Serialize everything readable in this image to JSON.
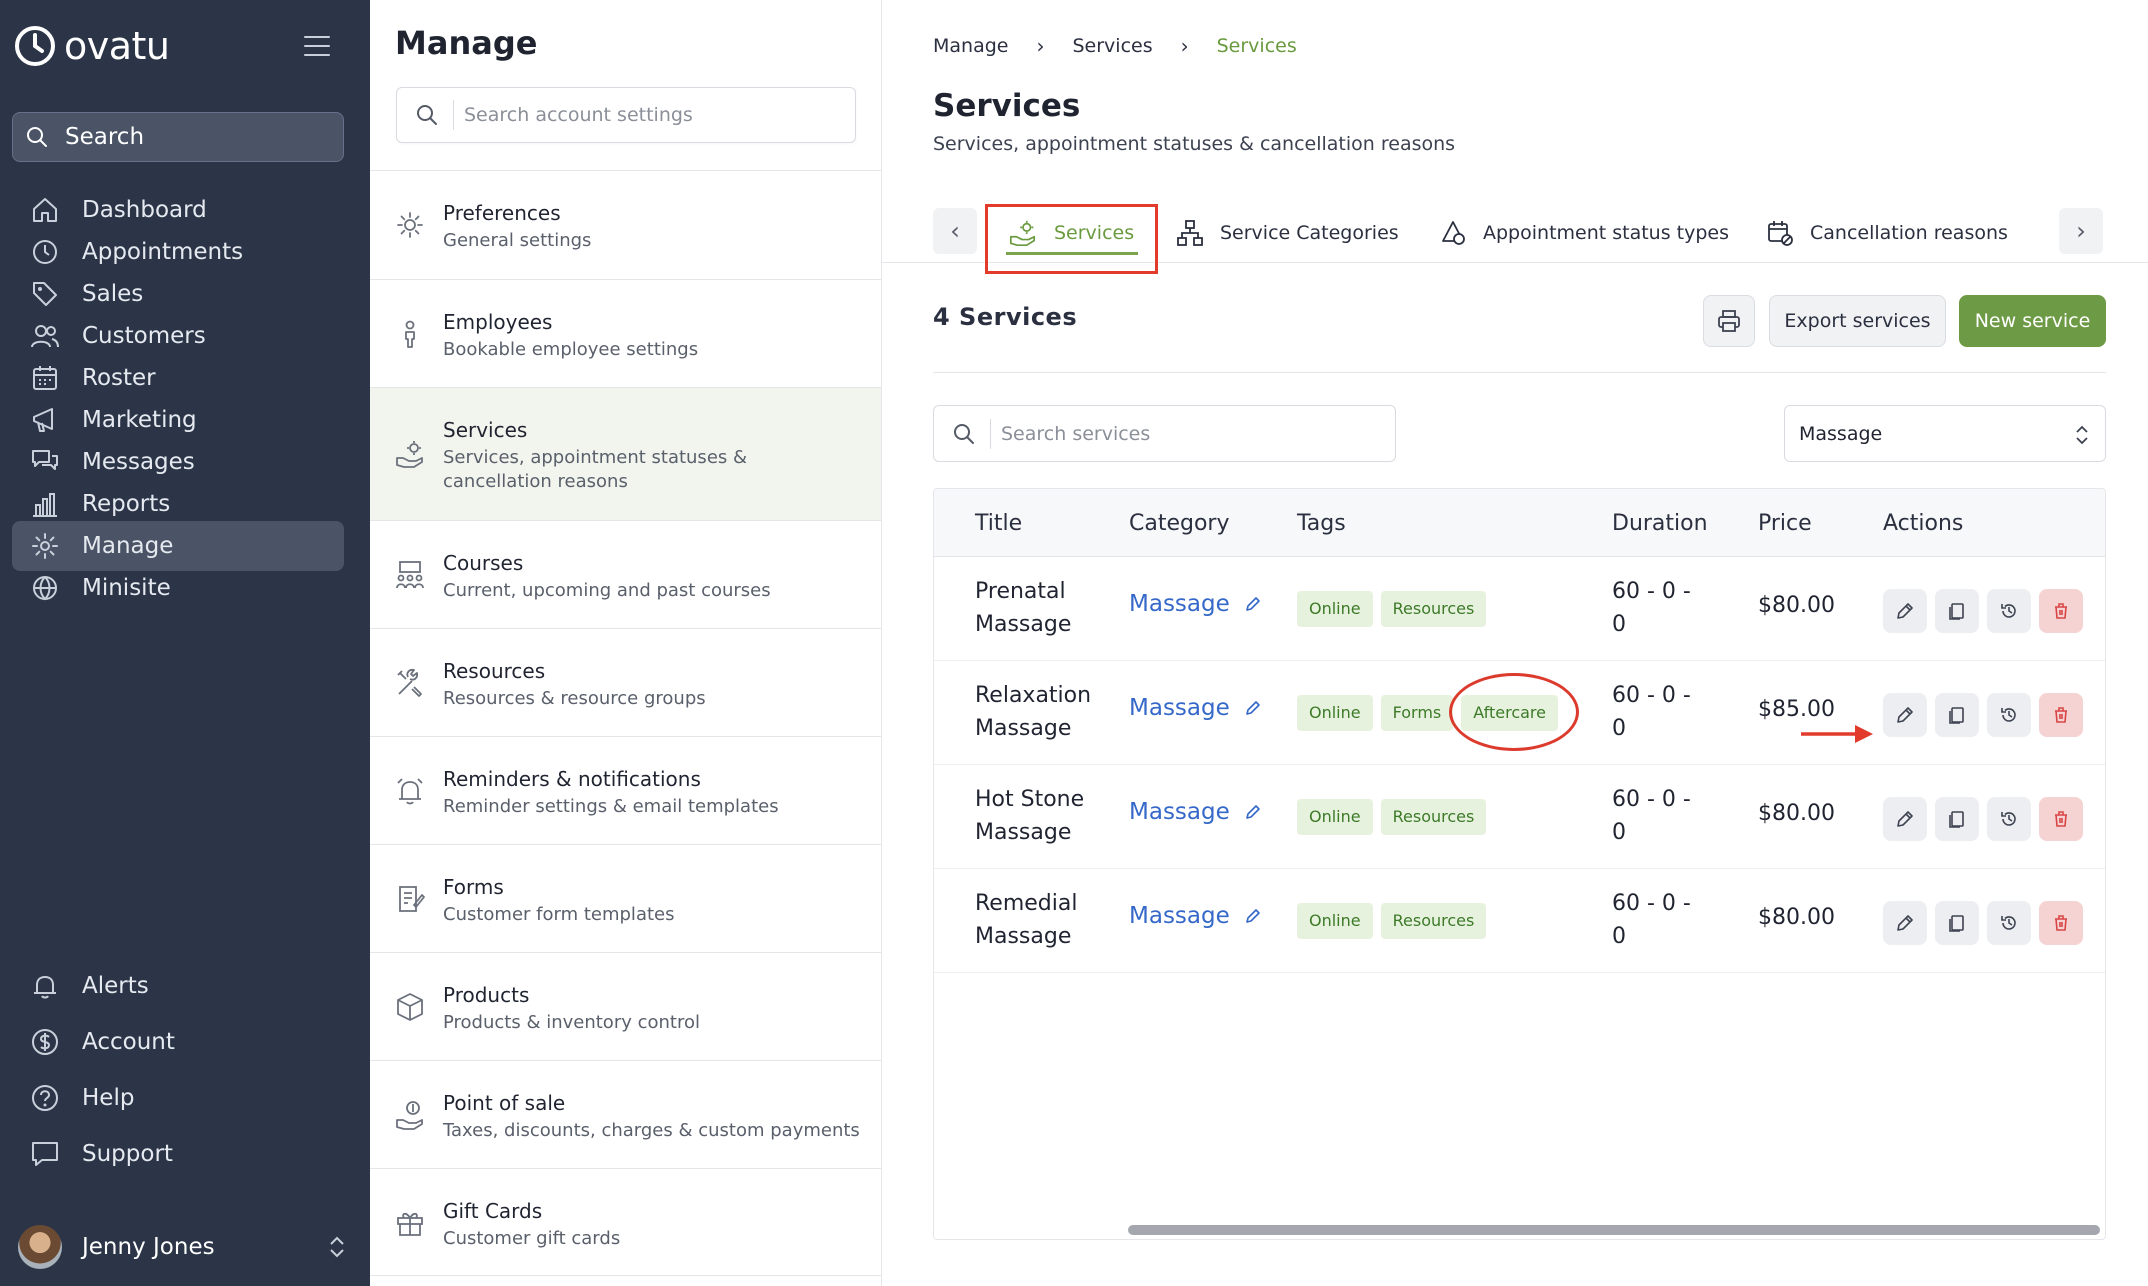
{
  "app": {
    "logo_text": "ovatu",
    "search_label": "Search"
  },
  "nav": {
    "items": [
      {
        "label": "Dashboard",
        "icon": "home-icon"
      },
      {
        "label": "Appointments",
        "icon": "clock-icon"
      },
      {
        "label": "Sales",
        "icon": "tag-icon"
      },
      {
        "label": "Customers",
        "icon": "users-icon"
      },
      {
        "label": "Roster",
        "icon": "calendar-icon"
      },
      {
        "label": "Marketing",
        "icon": "megaphone-icon"
      },
      {
        "label": "Messages",
        "icon": "chat-icon"
      },
      {
        "label": "Reports",
        "icon": "bar-chart-icon"
      },
      {
        "label": "Manage",
        "icon": "gear-icon"
      },
      {
        "label": "Minisite",
        "icon": "globe-icon"
      }
    ],
    "bottom_items": [
      {
        "label": "Alerts",
        "icon": "bell-icon"
      },
      {
        "label": "Account",
        "icon": "dollar-icon"
      },
      {
        "label": "Help",
        "icon": "help-icon"
      },
      {
        "label": "Support",
        "icon": "support-icon"
      }
    ],
    "user_name": "Jenny Jones"
  },
  "manage": {
    "title": "Manage",
    "search_placeholder": "Search account settings",
    "items": [
      {
        "title": "Preferences",
        "sub": "General settings"
      },
      {
        "title": "Employees",
        "sub": "Bookable employee settings"
      },
      {
        "title": "Services",
        "sub": "Services, appointment statuses & cancellation reasons"
      },
      {
        "title": "Courses",
        "sub": "Current, upcoming and past courses"
      },
      {
        "title": "Resources",
        "sub": "Resources & resource groups"
      },
      {
        "title": "Reminders & notifications",
        "sub": "Reminder settings & email templates"
      },
      {
        "title": "Forms",
        "sub": "Customer form templates"
      },
      {
        "title": "Products",
        "sub": "Products & inventory control"
      },
      {
        "title": "Point of sale",
        "sub": "Taxes, discounts, charges & custom payments"
      },
      {
        "title": "Gift Cards",
        "sub": "Customer gift cards"
      }
    ]
  },
  "breadcrumb": {
    "items": [
      "Manage",
      "Services",
      "Services"
    ]
  },
  "page": {
    "title": "Services",
    "subtitle": "Services, appointment statuses & cancellation reasons"
  },
  "tabs": {
    "items": [
      "Services",
      "Service Categories",
      "Appointment status types",
      "Cancellation reasons"
    ]
  },
  "toolbar": {
    "count": "4 Services",
    "export_label": "Export services",
    "new_label": "New service"
  },
  "filters": {
    "search_placeholder": "Search services",
    "category_value": "Massage"
  },
  "table": {
    "headers": [
      "Title",
      "Category",
      "Tags",
      "Duration",
      "Price",
      "Actions"
    ],
    "rows": [
      {
        "title": "Prenatal Massage",
        "category": "Massage",
        "tags": [
          "Online",
          "Resources"
        ],
        "duration": "60 - 0 - 0",
        "price": "$80.00"
      },
      {
        "title": "Relaxation Massage",
        "category": "Massage",
        "tags": [
          "Online",
          "Forms",
          "Aftercare"
        ],
        "duration": "60 - 0 - 0",
        "price": "$85.00"
      },
      {
        "title": "Hot Stone Massage",
        "category": "Massage",
        "tags": [
          "Online",
          "Resources"
        ],
        "duration": "60 - 0 - 0",
        "price": "$80.00"
      },
      {
        "title": "Remedial Massage",
        "category": "Massage",
        "tags": [
          "Online",
          "Resources"
        ],
        "duration": "60 - 0 - 0",
        "price": "$80.00"
      }
    ]
  },
  "colors": {
    "sidebar_bg": "#2b3547",
    "accent_green": "#6d9a45",
    "link_blue": "#3568c9",
    "highlight_red": "#e23b2c"
  }
}
